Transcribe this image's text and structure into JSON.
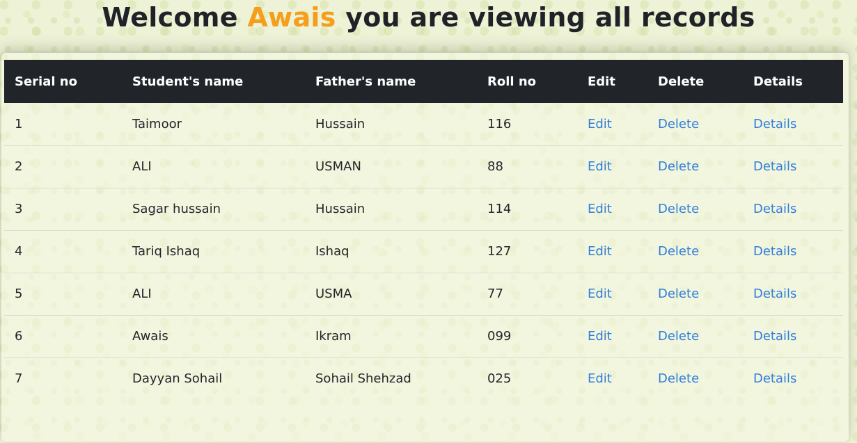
{
  "header": {
    "prefix": "Welcome",
    "user": "Awais",
    "suffix": "you are viewing all records"
  },
  "table": {
    "columns": [
      "Serial no",
      "Student's name",
      "Father's name",
      "Roll no",
      "Edit",
      "Delete",
      "Details"
    ],
    "rows": [
      {
        "serial": "1",
        "student": "Taimoor",
        "father": "Hussain",
        "roll": "116",
        "edit": "Edit",
        "delete": "Delete",
        "details": "Details"
      },
      {
        "serial": "2",
        "student": "ALI",
        "father": "USMAN",
        "roll": "88",
        "edit": "Edit",
        "delete": "Delete",
        "details": "Details"
      },
      {
        "serial": "3",
        "student": "Sagar hussain",
        "father": "Hussain",
        "roll": "114",
        "edit": "Edit",
        "delete": "Delete",
        "details": "Details"
      },
      {
        "serial": "4",
        "student": "Tariq Ishaq",
        "father": "Ishaq",
        "roll": "127",
        "edit": "Edit",
        "delete": "Delete",
        "details": "Details"
      },
      {
        "serial": "5",
        "student": "ALI",
        "father": "USMA",
        "roll": "77",
        "edit": "Edit",
        "delete": "Delete",
        "details": "Details"
      },
      {
        "serial": "6",
        "student": "Awais",
        "father": "Ikram",
        "roll": "099",
        "edit": "Edit",
        "delete": "Delete",
        "details": "Details"
      },
      {
        "serial": "7",
        "student": "Dayyan Sohail",
        "father": "Sohail Shehzad",
        "roll": "025",
        "edit": "Edit",
        "delete": "Delete",
        "details": "Details"
      }
    ]
  },
  "colors": {
    "accent_name": "#f59e1a",
    "link": "#2f7ddb",
    "header_bg": "#212529",
    "page_bg": "#eef2d6"
  }
}
